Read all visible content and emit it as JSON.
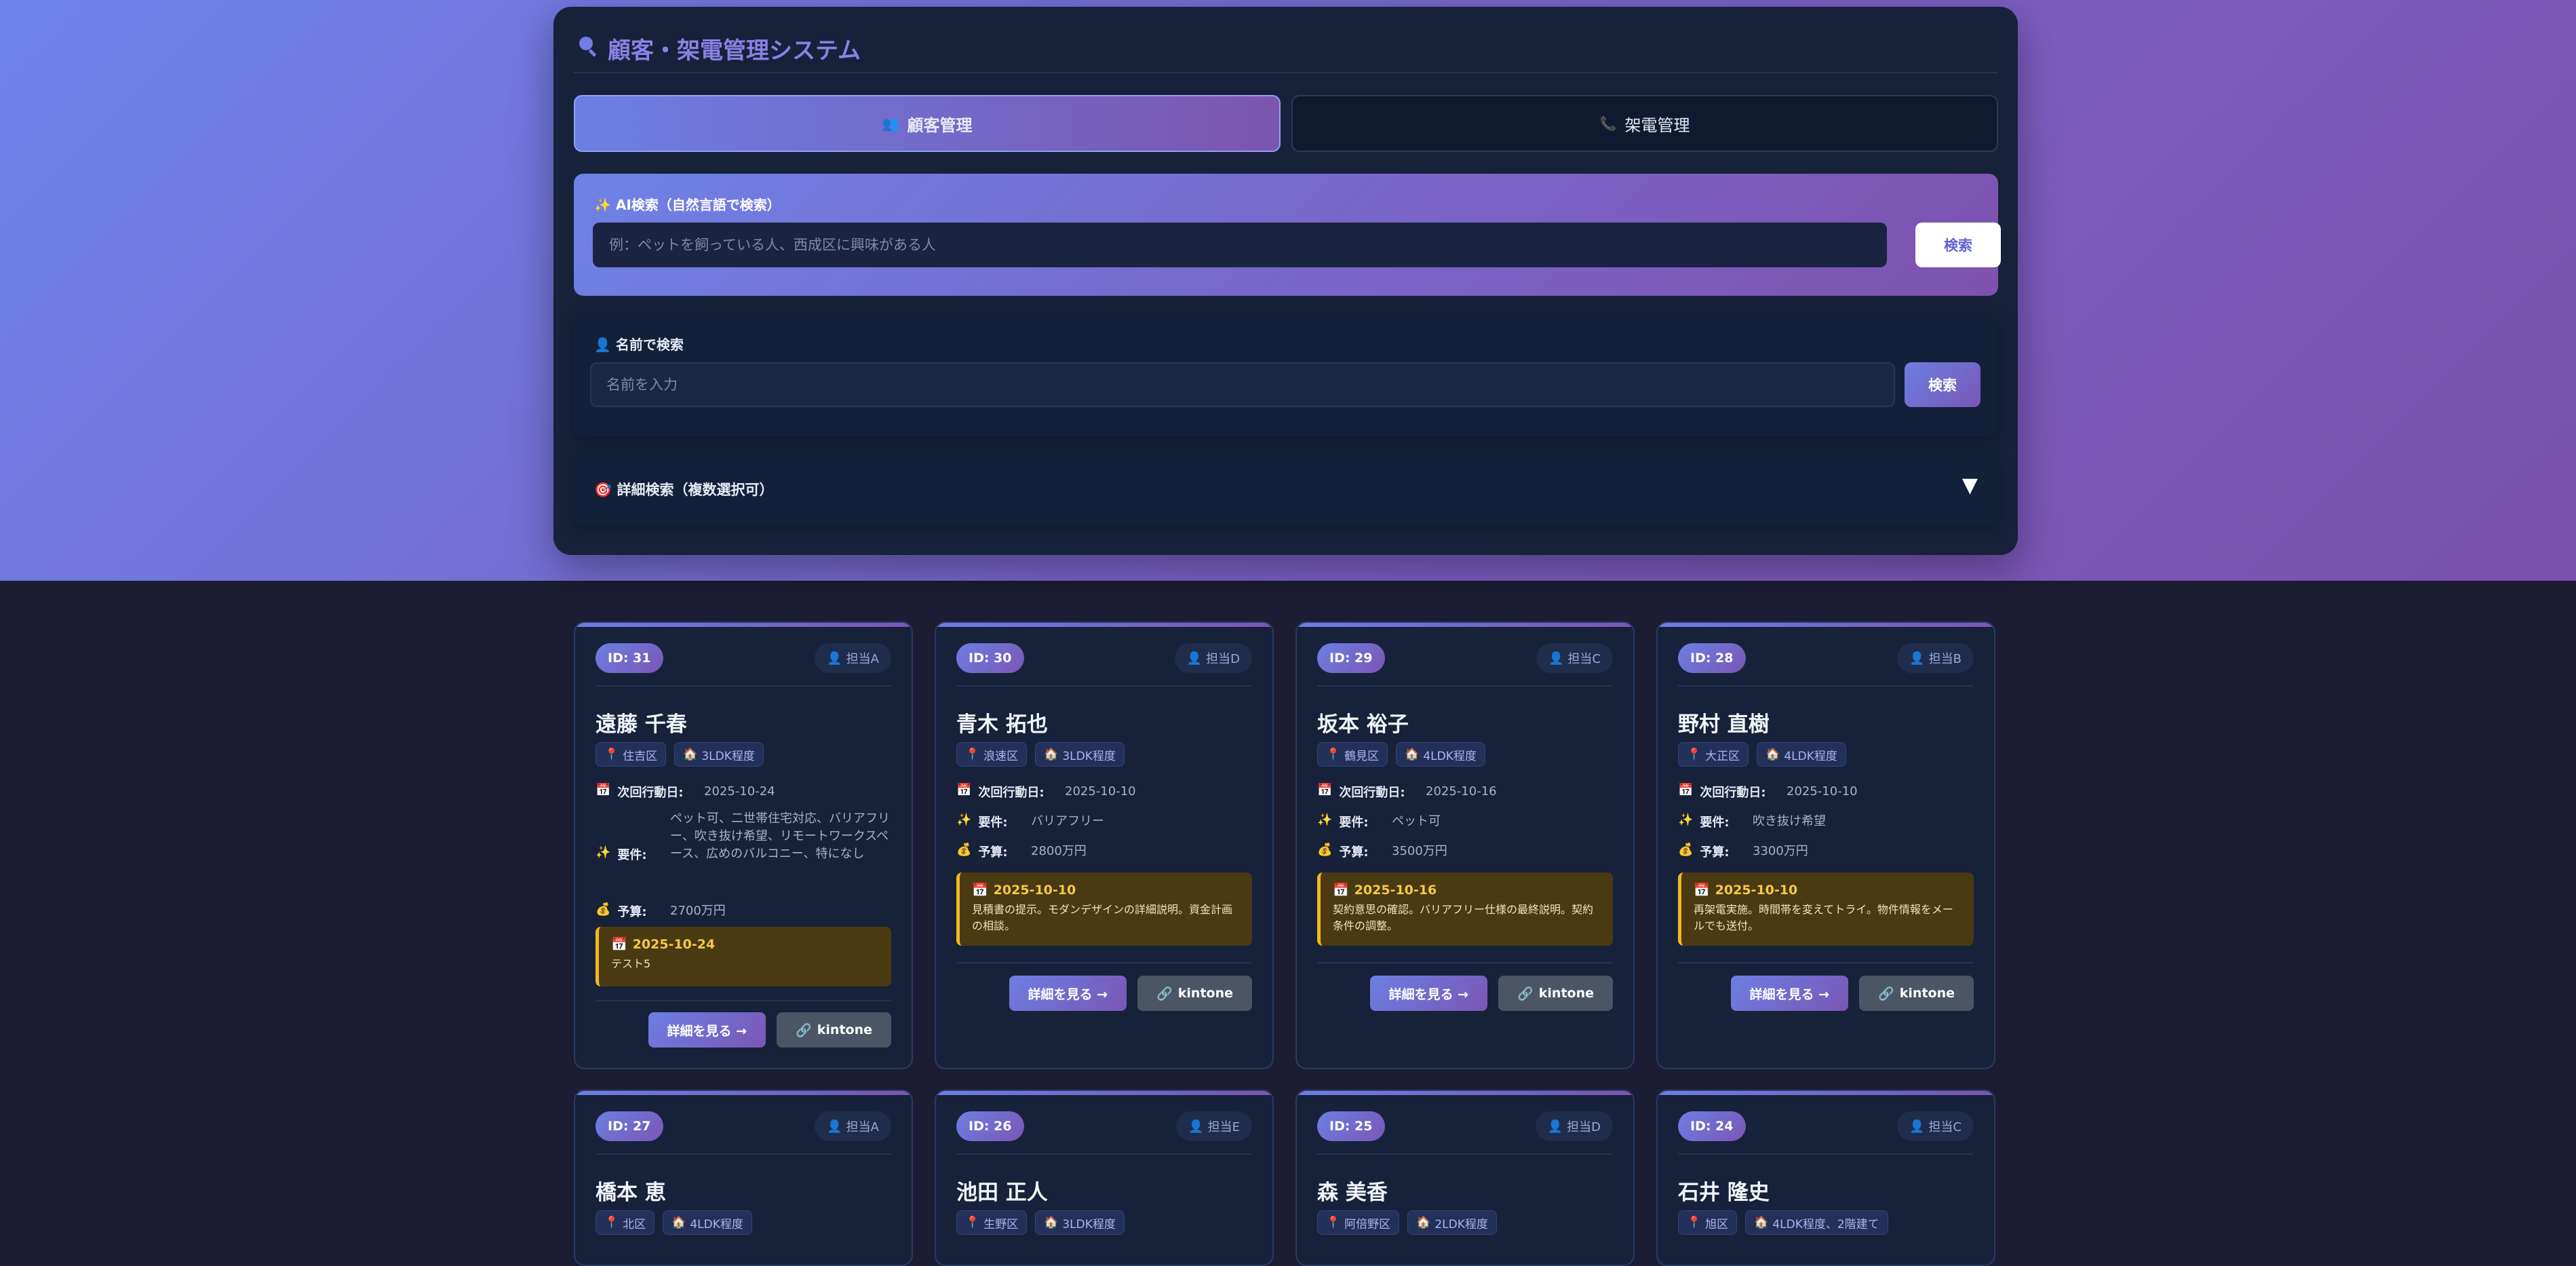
{
  "header": {
    "title": "顧客・架電管理システム",
    "icon": "search-icon",
    "tabs": [
      {
        "label": "顧客管理",
        "icon": "users-icon",
        "active": true
      },
      {
        "label": "架電管理",
        "icon": "phone-icon",
        "active": false
      }
    ]
  },
  "ai_search": {
    "label": "AI検索（自然言語で検索）",
    "placeholder": "例：ペットを飼っている人、西成区に興味がある人",
    "button": "検索"
  },
  "name_search": {
    "label": "名前で検索",
    "placeholder": "名前を入力",
    "button": "検索"
  },
  "detail_search": {
    "label": "詳細検索（複数選択可）",
    "toggle": "▼"
  },
  "labels": {
    "next_action": "次回行動日:",
    "requirements": "要件:",
    "budget": "予算:",
    "detail_button": "詳細を見る →",
    "kintone_button": "kintone"
  },
  "cards": [
    {
      "id": "ID: 31",
      "staff": "担当A",
      "name": "遠藤 千春",
      "area": "住吉区",
      "layout": "3LDK程度",
      "next_action": "2025-10-24",
      "requirements": "ペット可、二世帯住宅対応、バリアフリー、吹き抜け希望、リモートワークスペース、広めのバルコニー、特になし",
      "budget": "2700万円",
      "memo_date": "2025-10-24",
      "memo_text": "テスト5"
    },
    {
      "id": "ID: 30",
      "staff": "担当D",
      "name": "青木 拓也",
      "area": "浪速区",
      "layout": "3LDK程度",
      "next_action": "2025-10-10",
      "requirements": "バリアフリー",
      "budget": "2800万円",
      "memo_date": "2025-10-10",
      "memo_text": "見積書の提示。モダンデザインの詳細説明。資金計画の相談。"
    },
    {
      "id": "ID: 29",
      "staff": "担当C",
      "name": "坂本 裕子",
      "area": "鶴見区",
      "layout": "4LDK程度",
      "next_action": "2025-10-16",
      "requirements": "ペット可",
      "budget": "3500万円",
      "memo_date": "2025-10-16",
      "memo_text": "契約意思の確認。バリアフリー仕様の最終説明。契約条件の調整。"
    },
    {
      "id": "ID: 28",
      "staff": "担当B",
      "name": "野村 直樹",
      "area": "大正区",
      "layout": "4LDK程度",
      "next_action": "2025-10-10",
      "requirements": "吹き抜け希望",
      "budget": "3300万円",
      "memo_date": "2025-10-10",
      "memo_text": "再架電実施。時間帯を変えてトライ。物件情報をメールでも送付。"
    },
    {
      "id": "ID: 27",
      "staff": "担当A",
      "name": "橋本 恵",
      "area": "北区",
      "layout": "4LDK程度"
    },
    {
      "id": "ID: 26",
      "staff": "担当E",
      "name": "池田 正人",
      "area": "生野区",
      "layout": "3LDK程度"
    },
    {
      "id": "ID: 25",
      "staff": "担当D",
      "name": "森 美香",
      "area": "阿倍野区",
      "layout": "2LDK程度"
    },
    {
      "id": "ID: 24",
      "staff": "担当C",
      "name": "石井 隆史",
      "area": "旭区",
      "layout": "4LDK程度、2階建て"
    }
  ]
}
